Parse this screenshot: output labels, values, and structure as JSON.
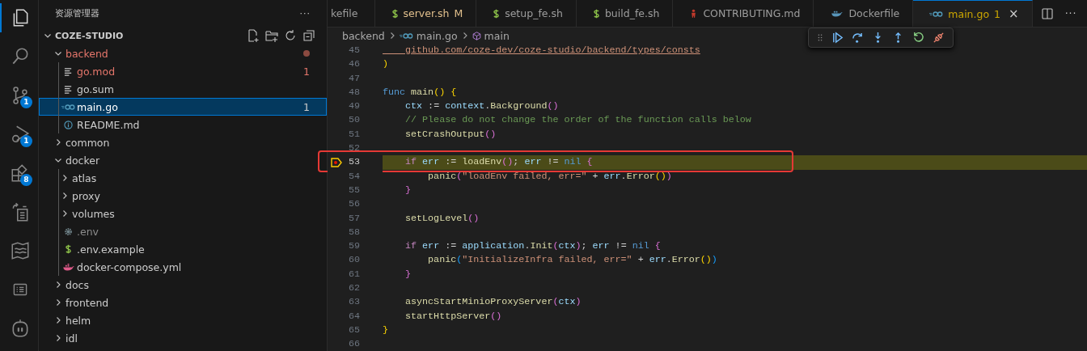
{
  "activity_bar": [
    {
      "kind": "explorer",
      "selected": true
    },
    {
      "kind": "search",
      "selected": false
    },
    {
      "kind": "source-control",
      "selected": false,
      "badge": "1"
    },
    {
      "kind": "run-debug",
      "selected": false,
      "badge": "1"
    },
    {
      "kind": "extensions",
      "selected": false,
      "badge": "8"
    },
    {
      "kind": "remote",
      "selected": false
    },
    {
      "kind": "map",
      "selected": false
    },
    {
      "kind": "list",
      "selected": false
    },
    {
      "kind": "robot",
      "selected": false
    }
  ],
  "sidebar": {
    "title": "资源管理器",
    "more": "···",
    "root": "COZE-STUDIO",
    "tree": [
      {
        "name": "backend",
        "kind": "folder",
        "expanded": true,
        "has_error": true,
        "ignored": false,
        "dot": true,
        "children": [
          {
            "name": "go.mod",
            "kind": "lines",
            "has_error": true,
            "ignored": false,
            "badge": "1",
            "selected": false
          },
          {
            "name": "go.sum",
            "kind": "lines",
            "has_error": false,
            "ignored": false,
            "selected": false
          },
          {
            "name": "main.go",
            "kind": "go",
            "has_error": false,
            "ignored": false,
            "badge": "1",
            "selected": true
          },
          {
            "name": "README.md",
            "kind": "info",
            "has_error": false,
            "ignored": false,
            "selected": false
          }
        ]
      },
      {
        "name": "common",
        "kind": "folder",
        "expanded": false,
        "has_error": false,
        "ignored": false
      },
      {
        "name": "docker",
        "kind": "folder",
        "expanded": true,
        "has_error": false,
        "ignored": false,
        "children": [
          {
            "name": "atlas",
            "kind": "folder",
            "expanded": false,
            "has_error": false,
            "ignored": false
          },
          {
            "name": "proxy",
            "kind": "folder",
            "expanded": false,
            "has_error": false,
            "ignored": false
          },
          {
            "name": "volumes",
            "kind": "folder",
            "expanded": false,
            "has_error": false,
            "ignored": false
          },
          {
            "name": ".env",
            "kind": "gear",
            "has_error": false,
            "ignored": true,
            "selected": false
          },
          {
            "name": ".env.example",
            "kind": "dollar",
            "has_error": false,
            "ignored": false,
            "selected": false
          },
          {
            "name": "docker-compose.yml",
            "kind": "docker",
            "has_error": false,
            "ignored": false,
            "selected": false
          }
        ]
      },
      {
        "name": "docs",
        "kind": "folder",
        "expanded": false,
        "has_error": false,
        "ignored": false
      },
      {
        "name": "frontend",
        "kind": "folder",
        "expanded": false,
        "has_error": false,
        "ignored": false
      },
      {
        "name": "helm",
        "kind": "folder",
        "expanded": false,
        "has_error": false,
        "ignored": false
      },
      {
        "name": "idl",
        "kind": "folder",
        "expanded": false,
        "has_error": false,
        "ignored": false
      }
    ]
  },
  "tabs": [
    {
      "label": "kefile",
      "modified": false,
      "problem": false,
      "selected": false
    },
    {
      "label": "server.sh",
      "kind": "dollar",
      "modified": true,
      "problem": false,
      "decoration": "M",
      "selected": false
    },
    {
      "label": "setup_fe.sh",
      "kind": "dollar",
      "modified": false,
      "problem": false,
      "selected": false
    },
    {
      "label": "build_fe.sh",
      "kind": "dollar",
      "modified": false,
      "problem": false,
      "selected": false
    },
    {
      "label": "CONTRIBUTING.md",
      "kind": "person",
      "modified": false,
      "problem": false,
      "selected": false
    },
    {
      "label": "Dockerfile",
      "kind": "docker",
      "modified": false,
      "problem": false,
      "selected": false
    },
    {
      "label": "main.go",
      "kind": "go",
      "modified": false,
      "problem": true,
      "decoration": "1",
      "close": "×",
      "selected": true
    }
  ],
  "editor_actions": {
    "more": "···"
  },
  "breadcrumb": [
    {
      "label": "backend"
    },
    {
      "label": "main.go",
      "kind": "go"
    },
    {
      "label": "main",
      "kind": "cube"
    }
  ],
  "code": [
    {
      "number": "45",
      "current": false,
      "annotated": false,
      "tokens": [
        {
          "text": "    github.com/coze-dev/coze-studio/backend/types/consts",
          "kind": "link"
        }
      ]
    },
    {
      "number": "46",
      "current": false,
      "annotated": false,
      "tokens": [
        {
          "text": ")",
          "kind": "bracket1"
        }
      ]
    },
    {
      "number": "47",
      "current": false,
      "annotated": false
    },
    {
      "number": "48",
      "current": false,
      "annotated": false,
      "tokens": [
        {
          "text": "func ",
          "kind": "keyword"
        },
        {
          "text": "main",
          "kind": "func"
        },
        {
          "text": "() {",
          "kind": "bracket1"
        }
      ]
    },
    {
      "number": "49",
      "current": false,
      "annotated": false,
      "tokens": [
        {
          "text": "    ctx",
          "kind": "var"
        },
        {
          "text": " := ",
          "kind": "plain"
        },
        {
          "text": "context",
          "kind": "var"
        },
        {
          "text": ".",
          "kind": "plain"
        },
        {
          "text": "Background",
          "kind": "func"
        },
        {
          "text": "()",
          "kind": "bracket2"
        }
      ]
    },
    {
      "number": "50",
      "current": false,
      "annotated": false,
      "tokens": [
        {
          "text": "    // Please do not change the order of the function calls below",
          "kind": "comment"
        }
      ]
    },
    {
      "number": "51",
      "current": false,
      "annotated": false,
      "tokens": [
        {
          "text": "    setCrashOutput",
          "kind": "func"
        },
        {
          "text": "()",
          "kind": "bracket2"
        }
      ]
    },
    {
      "number": "52",
      "current": false,
      "annotated": false
    },
    {
      "number": "53",
      "current": true,
      "annotated": true,
      "tokens": [
        {
          "text": "    if ",
          "kind": "control"
        },
        {
          "text": "err",
          "kind": "var"
        },
        {
          "text": " := ",
          "kind": "plain"
        },
        {
          "text": "loadEnv",
          "kind": "func"
        },
        {
          "text": "()",
          "kind": "bracket2"
        },
        {
          "text": "; ",
          "kind": "plain"
        },
        {
          "text": "err",
          "kind": "var"
        },
        {
          "text": " != ",
          "kind": "plain"
        },
        {
          "text": "nil ",
          "kind": "keyword"
        },
        {
          "text": "{",
          "kind": "bracket2"
        }
      ]
    },
    {
      "number": "54",
      "current": false,
      "annotated": false,
      "tokens": [
        {
          "text": "        panic",
          "kind": "func"
        },
        {
          "text": "(",
          "kind": "bracket2"
        },
        {
          "text": "\"loadEnv failed, err=\"",
          "kind": "string"
        },
        {
          "text": " + ",
          "kind": "plain"
        },
        {
          "text": "err",
          "kind": "var"
        },
        {
          "text": ".",
          "kind": "plain"
        },
        {
          "text": "Error",
          "kind": "func"
        },
        {
          "text": "()",
          "kind": "bracket1"
        },
        {
          "text": ")",
          "kind": "bracket2"
        }
      ]
    },
    {
      "number": "55",
      "current": false,
      "annotated": false,
      "tokens": [
        {
          "text": "    }",
          "kind": "bracket2"
        }
      ]
    },
    {
      "number": "56",
      "current": false,
      "annotated": false
    },
    {
      "number": "57",
      "current": false,
      "annotated": false,
      "tokens": [
        {
          "text": "    setLogLevel",
          "kind": "func"
        },
        {
          "text": "()",
          "kind": "bracket2"
        }
      ]
    },
    {
      "number": "58",
      "current": false,
      "annotated": false
    },
    {
      "number": "59",
      "current": false,
      "annotated": false,
      "tokens": [
        {
          "text": "    if ",
          "kind": "control"
        },
        {
          "text": "err",
          "kind": "var"
        },
        {
          "text": " := ",
          "kind": "plain"
        },
        {
          "text": "application",
          "kind": "var"
        },
        {
          "text": ".",
          "kind": "plain"
        },
        {
          "text": "Init",
          "kind": "func"
        },
        {
          "text": "(",
          "kind": "bracket2"
        },
        {
          "text": "ctx",
          "kind": "var"
        },
        {
          "text": ")",
          "kind": "bracket2"
        },
        {
          "text": "; ",
          "kind": "plain"
        },
        {
          "text": "err",
          "kind": "var"
        },
        {
          "text": " != ",
          "kind": "plain"
        },
        {
          "text": "nil ",
          "kind": "keyword"
        },
        {
          "text": "{",
          "kind": "bracket2"
        }
      ]
    },
    {
      "number": "60",
      "current": false,
      "annotated": false,
      "tokens": [
        {
          "text": "        panic",
          "kind": "func"
        },
        {
          "text": "(",
          "kind": "bracket3"
        },
        {
          "text": "\"InitializeInfra failed, err=\"",
          "kind": "string"
        },
        {
          "text": " + ",
          "kind": "plain"
        },
        {
          "text": "err",
          "kind": "var"
        },
        {
          "text": ".",
          "kind": "plain"
        },
        {
          "text": "Error",
          "kind": "func"
        },
        {
          "text": "()",
          "kind": "bracket1"
        },
        {
          "text": ")",
          "kind": "bracket3"
        }
      ]
    },
    {
      "number": "61",
      "current": false,
      "annotated": false,
      "tokens": [
        {
          "text": "    }",
          "kind": "bracket2"
        }
      ]
    },
    {
      "number": "62",
      "current": false,
      "annotated": false
    },
    {
      "number": "63",
      "current": false,
      "annotated": false,
      "tokens": [
        {
          "text": "    asyncStartMinioProxyServer",
          "kind": "func"
        },
        {
          "text": "(",
          "kind": "bracket2"
        },
        {
          "text": "ctx",
          "kind": "var"
        },
        {
          "text": ")",
          "kind": "bracket2"
        }
      ]
    },
    {
      "number": "64",
      "current": false,
      "annotated": false,
      "tokens": [
        {
          "text": "    startHttpServer",
          "kind": "func"
        },
        {
          "text": "()",
          "kind": "bracket2"
        }
      ]
    },
    {
      "number": "65",
      "current": false,
      "annotated": false,
      "tokens": [
        {
          "text": "}",
          "kind": "bracket1"
        }
      ]
    },
    {
      "number": "66",
      "current": false,
      "annotated": false
    }
  ]
}
